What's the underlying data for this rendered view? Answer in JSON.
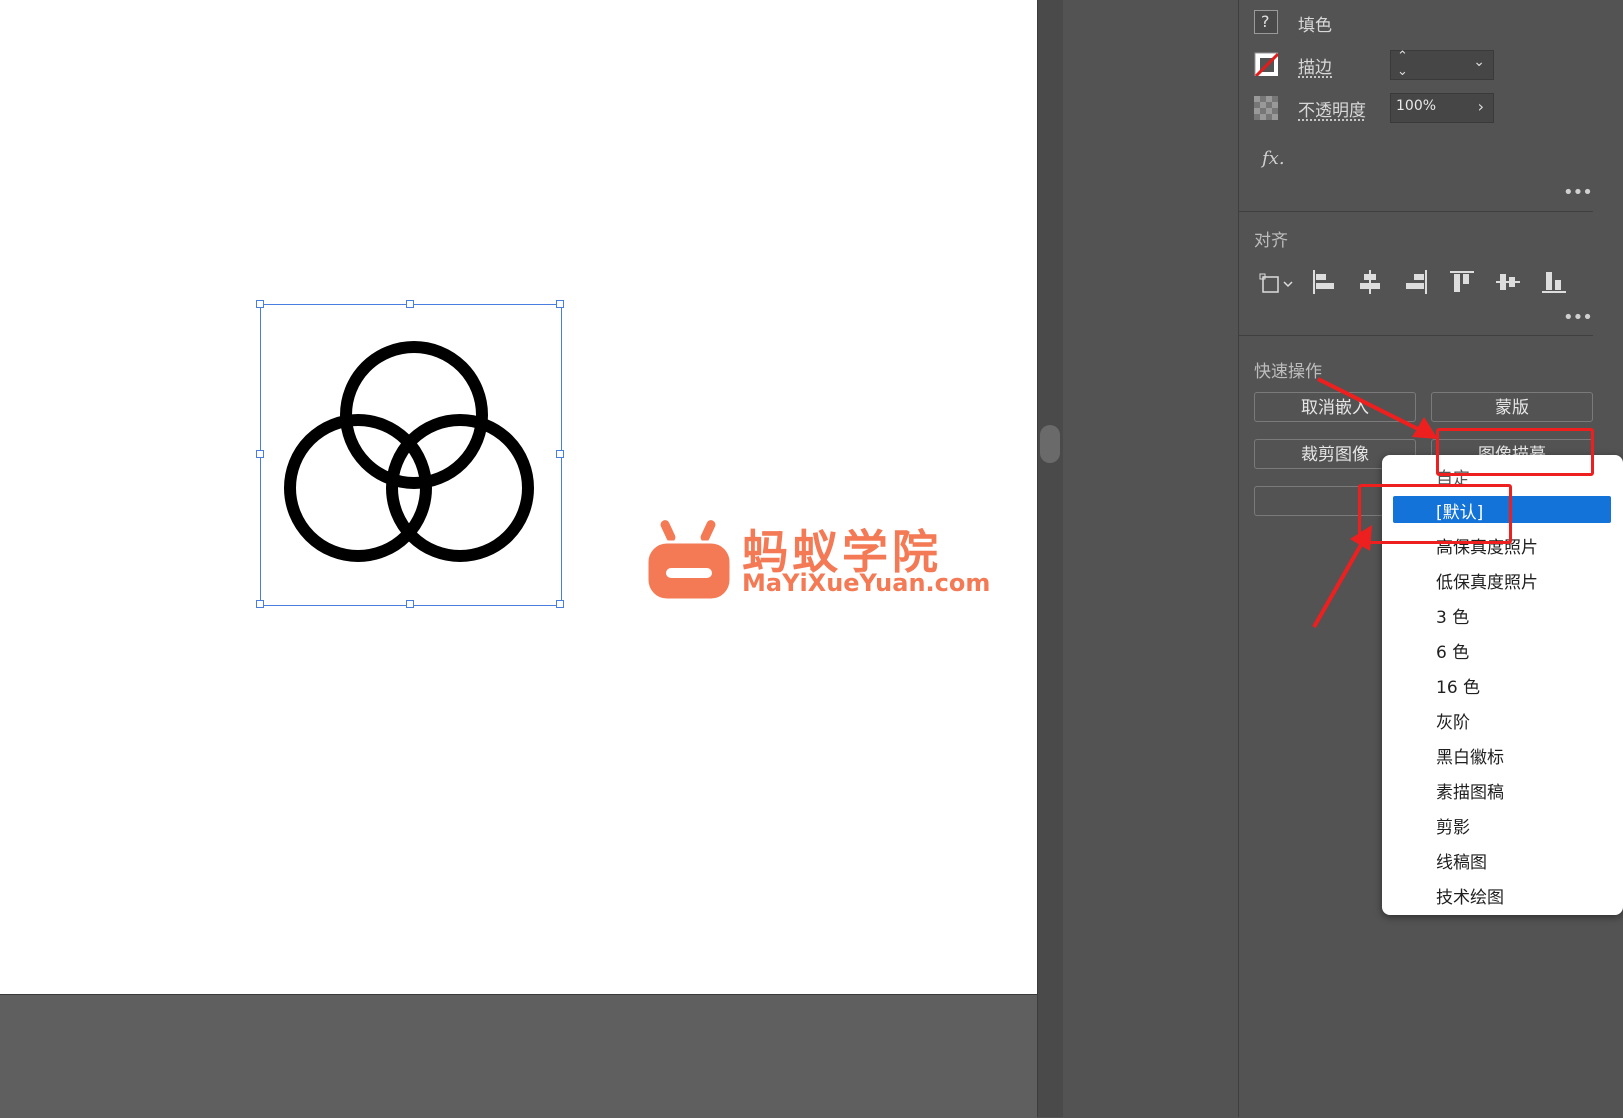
{
  "canvas": {
    "watermark": {
      "title": "蚂蚁学院",
      "url": "MaYiXueYuan.com"
    }
  },
  "appearance": {
    "fill_label": "填色",
    "fill_icon": "question-mark-icon",
    "stroke_label": "描边",
    "opacity_label": "不透明度",
    "opacity_value": "100%",
    "fx_label": "fx."
  },
  "align": {
    "title": "对齐"
  },
  "quick_actions": {
    "title": "快速操作",
    "unembed": "取消嵌入",
    "mask": "蒙版",
    "crop": "裁剪图像",
    "image_trace": "图像描摹"
  },
  "trace_menu": {
    "header_partial": "自定",
    "selected": "[默认]",
    "items": [
      "高保真度照片",
      "低保真度照片",
      "3 色",
      "6 色",
      "16 色",
      "灰阶",
      "黑白徽标",
      "素描图稿",
      "剪影",
      "线稿图",
      "技术绘图"
    ]
  },
  "colors": {
    "accent": "#1373d9",
    "annotation": "#ee1f1f",
    "watermark": "#f47a55",
    "selection": "#4a7de0"
  }
}
